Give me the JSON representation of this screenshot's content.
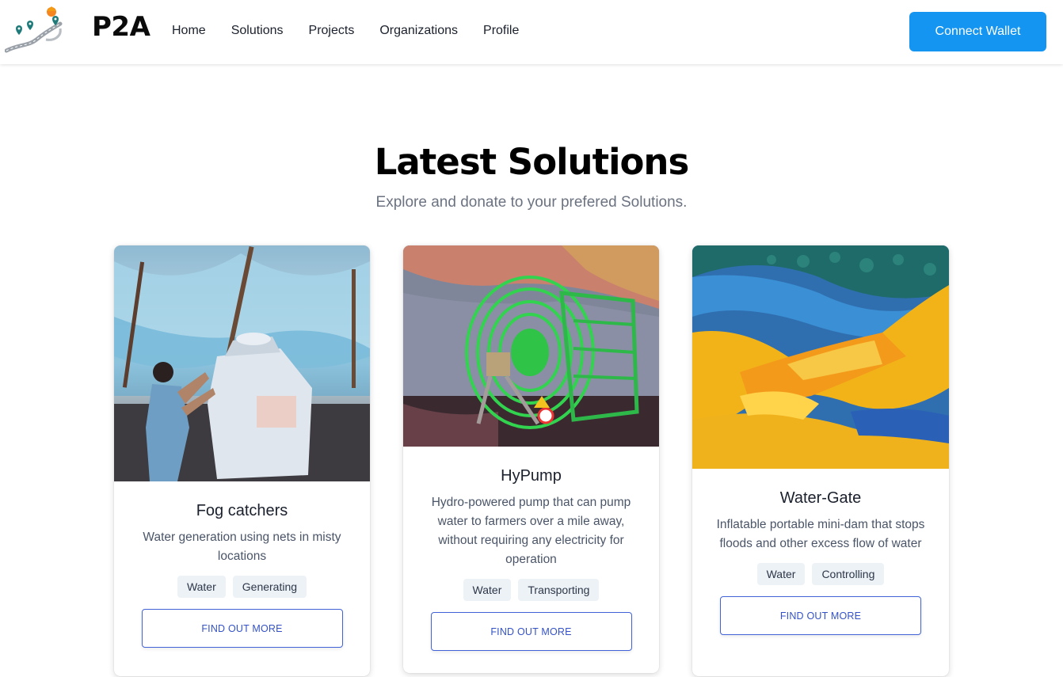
{
  "header": {
    "brand": "P2A",
    "nav": [
      "Home",
      "Solutions",
      "Projects",
      "Organizations",
      "Profile"
    ],
    "connect_label": "Connect Wallet"
  },
  "section": {
    "title": "Latest Solutions",
    "subtitle": "Explore and donate to your prefered Solutions."
  },
  "cards": [
    {
      "title": "Fog catchers",
      "description": "Water generation using nets in misty locations",
      "tags": [
        "Water",
        "Generating"
      ],
      "button": "FIND OUT MORE"
    },
    {
      "title": "HyPump",
      "description": "Hydro-powered pump that can pump water to farmers over a mile away, without requiring any electricity for operation",
      "tags": [
        "Water",
        "Transporting"
      ],
      "button": "FIND OUT MORE"
    },
    {
      "title": "Water-Gate",
      "description": "Inflatable portable mini-dam that stops floods and other excess flow of water",
      "tags": [
        "Water",
        "Controlling"
      ],
      "button": "FIND OUT MORE"
    }
  ],
  "colors": {
    "primary": "#1595f2",
    "link_blue": "#3452c6",
    "tag_bg": "#edf2f7"
  }
}
